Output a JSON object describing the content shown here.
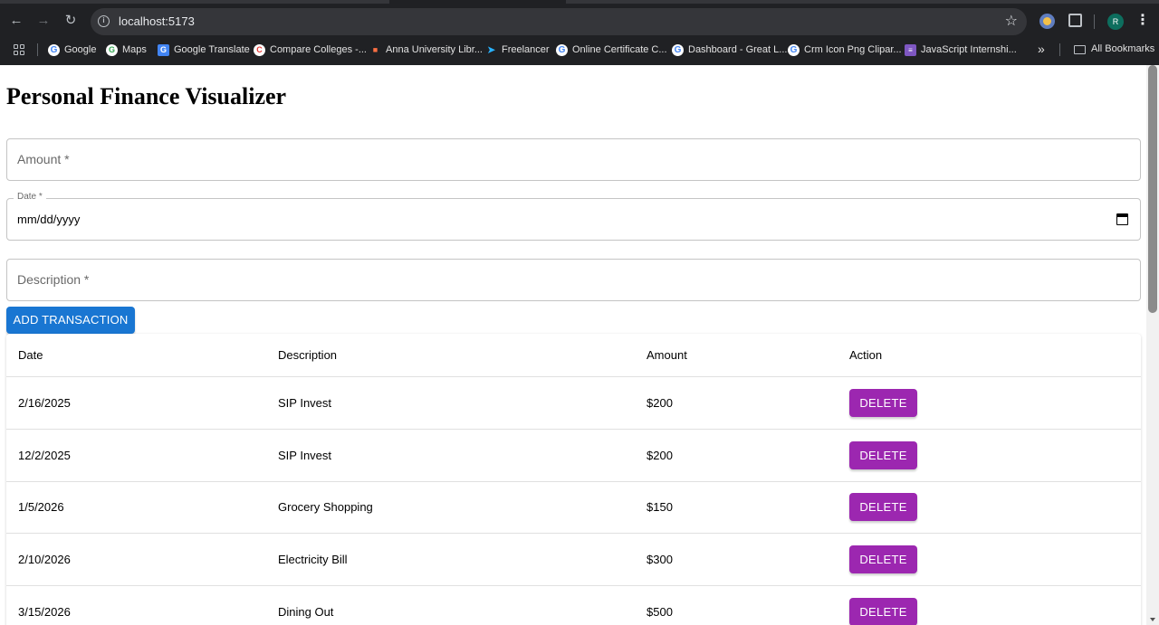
{
  "browser": {
    "url": "localhost:5173",
    "bookmarks": [
      {
        "label": "Google",
        "icon": "google-icon"
      },
      {
        "label": "Maps",
        "icon": "google-icon"
      },
      {
        "label": "Google Translate",
        "icon": "translate-icon"
      },
      {
        "label": "Compare Colleges -...",
        "icon": "college-icon"
      },
      {
        "label": "Anna University Libr...",
        "icon": "university-icon"
      },
      {
        "label": "Freelancer",
        "icon": "freelancer-icon"
      },
      {
        "label": "Online Certificate C...",
        "icon": "google-icon"
      },
      {
        "label": "Dashboard - Great L...",
        "icon": "google-icon"
      },
      {
        "label": "Crm Icon Png Clipar...",
        "icon": "google-icon"
      },
      {
        "label": "JavaScript Internshi...",
        "icon": "list-icon"
      }
    ],
    "all_bookmarks": "All Bookmarks",
    "profile_initial": "R"
  },
  "app": {
    "title": "Personal Finance Visualizer",
    "form": {
      "amount_placeholder": "Amount *",
      "date_label": "Date *",
      "date_value": "mm/dd/yyyy",
      "description_placeholder": "Description *",
      "submit_label": "ADD TRANSACTION"
    },
    "table": {
      "headers": {
        "date": "Date",
        "description": "Description",
        "amount": "Amount",
        "action": "Action"
      },
      "rows": [
        {
          "date": "2/16/2025",
          "description": "SIP Invest",
          "amount": "$200",
          "action": "DELETE"
        },
        {
          "date": "12/2/2025",
          "description": "SIP Invest",
          "amount": "$200",
          "action": "DELETE"
        },
        {
          "date": "1/5/2026",
          "description": "Grocery Shopping",
          "amount": "$150",
          "action": "DELETE"
        },
        {
          "date": "2/10/2026",
          "description": "Electricity Bill",
          "amount": "$300",
          "action": "DELETE"
        },
        {
          "date": "3/15/2026",
          "description": "Dining Out",
          "amount": "$500",
          "action": "DELETE"
        }
      ]
    }
  },
  "colors": {
    "primary": "#1976d2",
    "delete": "#9c27b0",
    "chrome_bg": "#202124"
  }
}
